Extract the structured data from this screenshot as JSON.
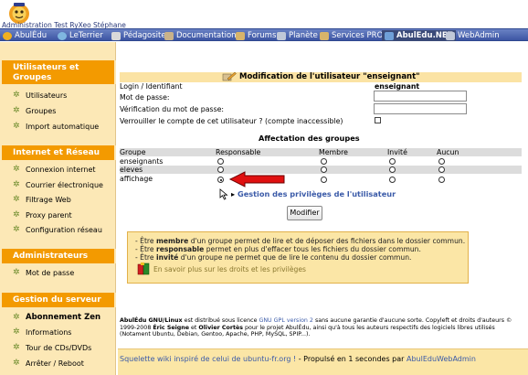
{
  "header": {
    "site_name": "Administration Test RyXeo Stéphane"
  },
  "nav": [
    {
      "label": "AbulÉdu",
      "icon": "abuledu-icon"
    },
    {
      "label": "LeTerrier",
      "icon": "terrier-icon"
    },
    {
      "label": "Pédagosite",
      "icon": "pedagosite-icon"
    },
    {
      "label": "Documentation",
      "icon": "documentation-icon"
    },
    {
      "label": "Forums",
      "icon": "forums-icon"
    },
    {
      "label": "Planète",
      "icon": "planete-icon"
    },
    {
      "label": "Services PRO",
      "icon": "services-icon"
    },
    {
      "label": "AbulEdu.NET",
      "icon": "abuledu-net-icon"
    },
    {
      "label": "WebAdmin",
      "icon": "webadmin-icon"
    }
  ],
  "sidebar": {
    "sections": [
      {
        "title_line1": "Utilisateurs et",
        "title_line2": "Groupes",
        "items": [
          "Utilisateurs",
          "Groupes",
          "Import automatique"
        ]
      },
      {
        "title": "Internet et Réseau",
        "items": [
          "Connexion internet",
          "Courrier électronique",
          "Filtrage Web",
          "Proxy parent",
          "Configuration réseau"
        ]
      },
      {
        "title": "Administrateurs",
        "items": [
          "Mot de passe"
        ]
      },
      {
        "title": "Gestion du serveur",
        "items": [
          "Abonnement Zen",
          "Informations",
          "Tour de CDs/DVDs",
          "Arrêter / Reboot"
        ]
      }
    ]
  },
  "form": {
    "title": "Modification de l'utilisateur \"enseignant\"",
    "login_label": "Login / Identifiant",
    "login_value": "enseignant",
    "password_label": "Mot de passe:",
    "password_value": "",
    "verify_label": "Vérification du mot de passe:",
    "verify_value": "",
    "lock_label": "Verrouiller le compte de cet utilisateur ? (compte inaccessible)",
    "lock_checked": false
  },
  "groups": {
    "heading": "Affectation des groupes",
    "columns": [
      "Groupe",
      "Responsable",
      "Membre",
      "Invité",
      "Aucun"
    ],
    "rows": [
      {
        "name": "enseignants",
        "selected": null
      },
      {
        "name": "eleves",
        "selected": null
      },
      {
        "name": "affichage",
        "selected": "Responsable"
      }
    ],
    "privileges_link": "Gestion des privilèges de l'utilisateur",
    "submit_label": "Modifier"
  },
  "info": {
    "line1_prefix": "- Être ",
    "line1_bold": "membre",
    "line1_rest": " d'un groupe permet de lire et de déposer des fichiers dans le dossier commun.",
    "line2_prefix": "- Être ",
    "line2_bold": "responsable",
    "line2_rest": " permet en plus d'effacer tous les fichiers du dossier commun.",
    "line3_prefix": "- Être ",
    "line3_bold": "invité",
    "line3_rest": " d'un groupe ne permet que de lire le contenu du dossier commun.",
    "more_link": "En savoir plus sur les droits et les privilèges"
  },
  "footer": {
    "license_line1_a": "AbulÉdu GNU/Linux",
    "license_line1_b": " est distribué sous licence ",
    "license_link": "GNU GPL version 2",
    "license_line1_c": " sans aucune garantie d'aucune sorte. Copyleft et droits d'auteurs ©",
    "license_line2_a": "1999-2008 ",
    "license_line2_b": "Éric Seigne",
    "license_line2_c": " et ",
    "license_line2_d": "Olivier Cortès",
    "license_line2_e": " pour le projet AbulÉdu, ainsi qu'à tous les auteurs respectifs des logiciels libres utilisés",
    "license_line3": "(Notament Ubuntu, Debian, Gentoo, Apache, PHP, MySQL, SPIP...).",
    "bottom_link": "Squelette wiki inspiré de celui de ubuntu-fr.org !",
    "bottom_text": " - Propulsé en 1 secondes par ",
    "bottom_link2": "AbulEduWebAdmin"
  },
  "colors": {
    "nav_blue": "#4a63b0",
    "sidebar_bg": "#fce8b6",
    "section_orange": "#f39a00",
    "title_bar": "#fbe3a4",
    "arrow_red": "#e01010",
    "link_blue": "#3a5aa8"
  }
}
